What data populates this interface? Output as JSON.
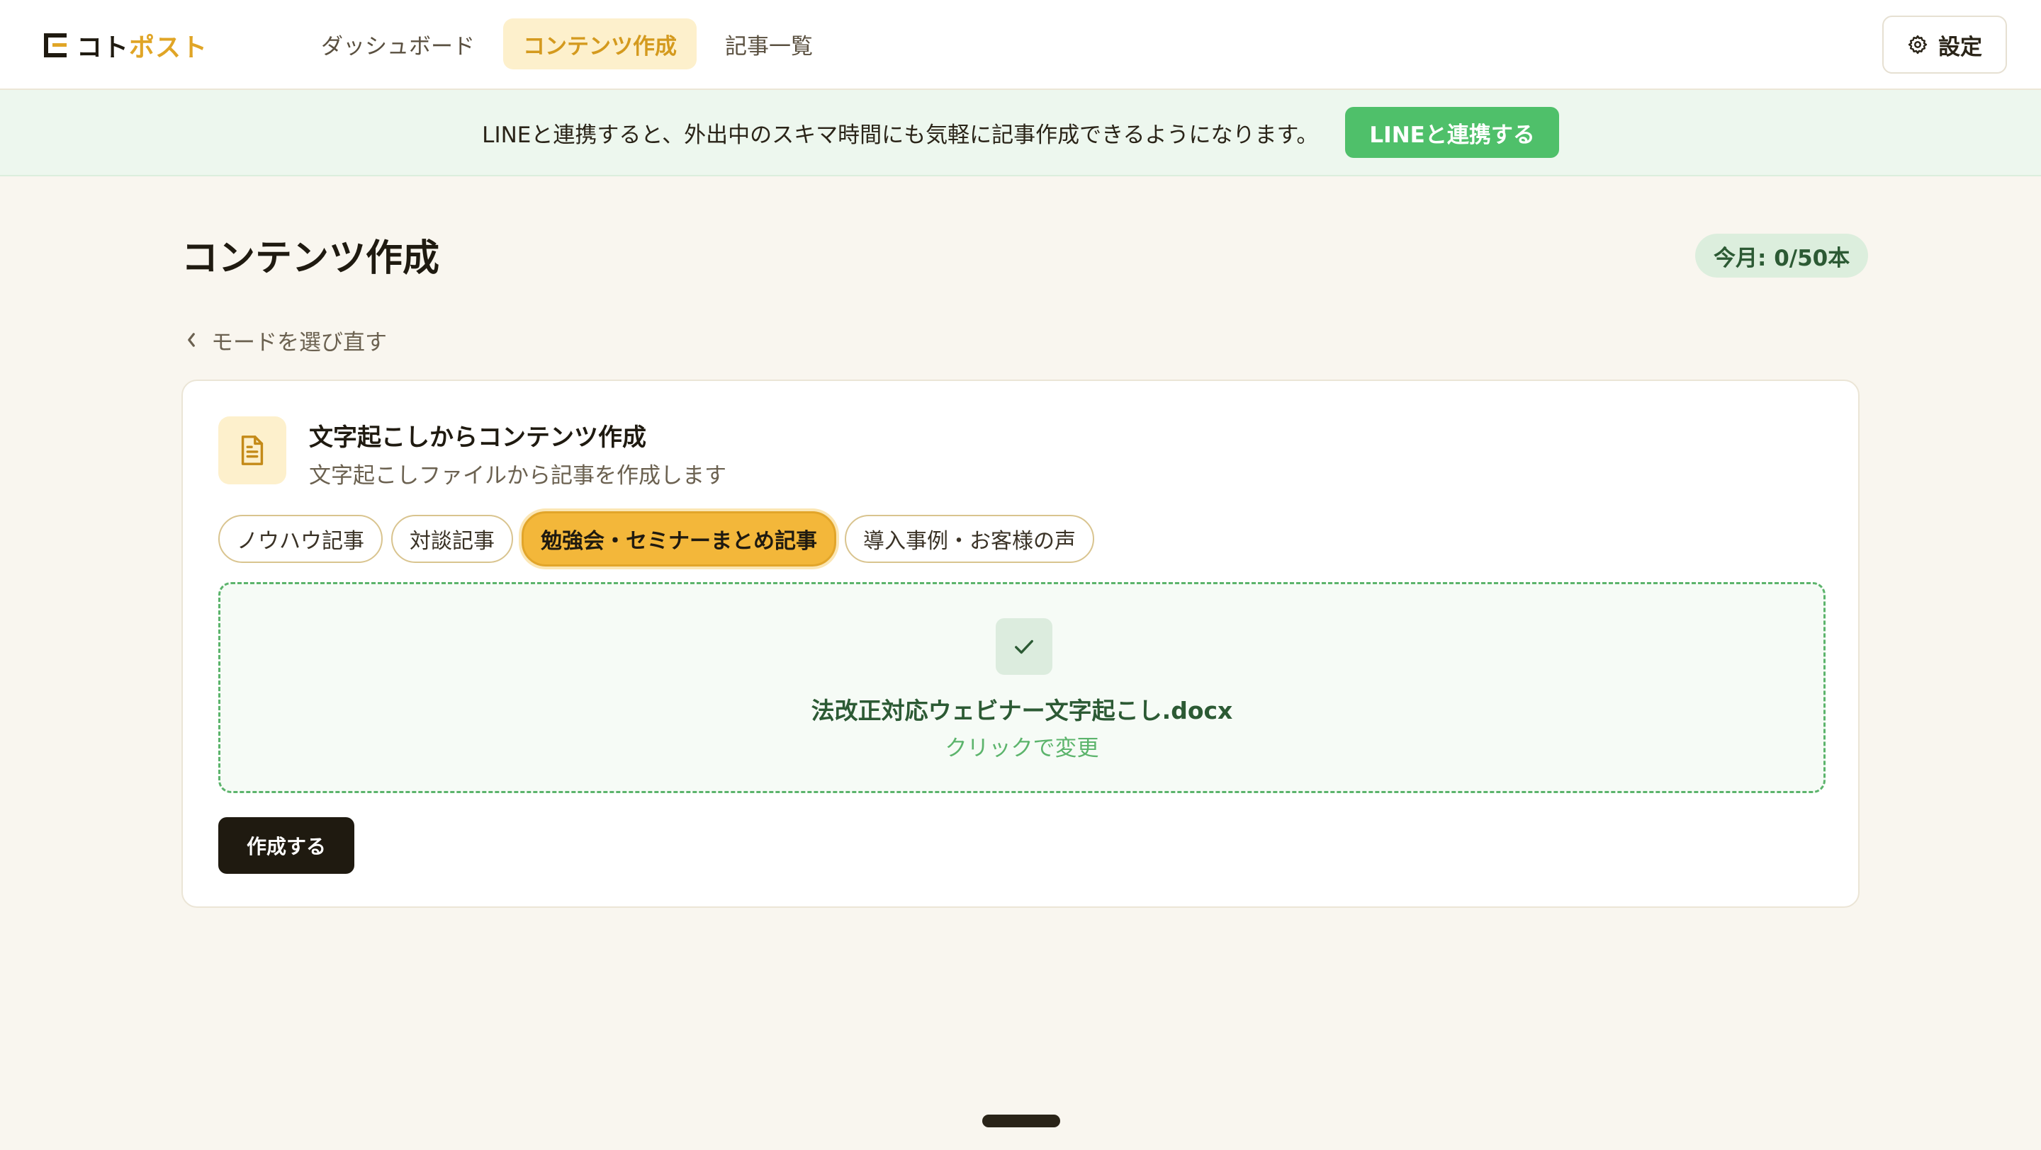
{
  "header": {
    "logo": {
      "part1": "コト",
      "part2": "ポスト"
    },
    "nav": [
      {
        "label": "ダッシュボード",
        "active": false
      },
      {
        "label": "コンテンツ作成",
        "active": true
      },
      {
        "label": "記事一覧",
        "active": false
      }
    ],
    "settings_label": "設定"
  },
  "banner": {
    "text": "LINEと連携すると、外出中のスキマ時間にも気軽に記事作成できるようになります。",
    "button_label": "LINEと連携する"
  },
  "page": {
    "title": "コンテンツ作成",
    "quota": "今月: 0/50本",
    "back_link": "モードを選び直す"
  },
  "card": {
    "title": "文字起こしからコンテンツ作成",
    "subtitle": "文字起こしファイルから記事を作成します",
    "article_types": [
      {
        "label": "ノウハウ記事",
        "selected": false
      },
      {
        "label": "対談記事",
        "selected": false
      },
      {
        "label": "勉強会・セミナーまとめ記事",
        "selected": true
      },
      {
        "label": "導入事例・お客様の声",
        "selected": false
      }
    ],
    "upload": {
      "file_name": "法改正対応ウェビナー文字起こし.docx",
      "change_hint": "クリックで変更"
    },
    "create_label": "作成する"
  },
  "colors": {
    "accent": "#e0a526",
    "selected_tab": "#f3b73a",
    "line_green": "#4fc06a",
    "upload_green": "#5cb46c",
    "background": "#f9f6ef"
  }
}
